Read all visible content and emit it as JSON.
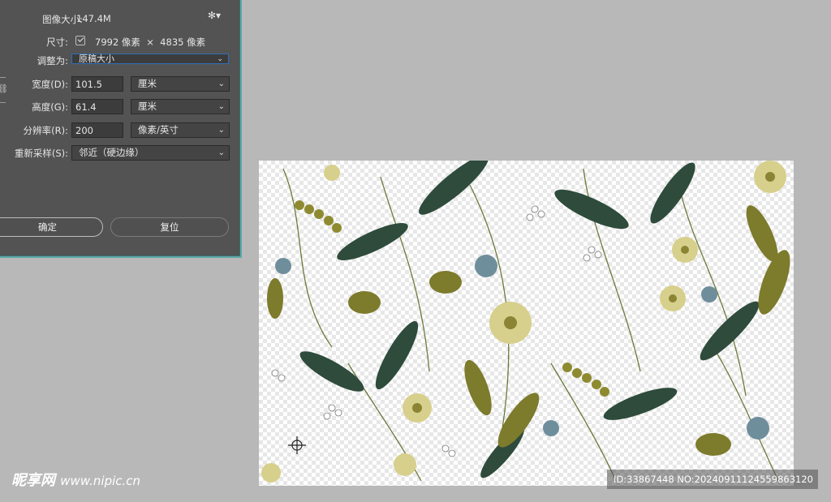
{
  "dialog": {
    "image_size_label": "图像大小:",
    "image_size_value": "147.4M",
    "dimensions_label": "尺寸:",
    "dimensions_value": "7992 像素  ×  4835 像素",
    "fit_to_label": "调整为:",
    "fit_to_value": "原稿大小",
    "width_label": "宽度(D):",
    "width_value": "101.5",
    "width_unit": "厘米",
    "height_label": "高度(G):",
    "height_value": "61.4",
    "height_unit": "厘米",
    "resolution_label": "分辨率(R):",
    "resolution_value": "200",
    "resolution_unit": "像素/英寸",
    "resample_label": "重新采样(S):",
    "resample_value": "邻近（硬边缘）",
    "ok_label": "确定",
    "reset_label": "复位",
    "gear_icon": "gear-icon"
  },
  "watermark": {
    "brand": "昵享网",
    "url": "www.nipic.cn",
    "id_text": "ID:33867448 NO:20240911124559863120"
  },
  "colors": {
    "workspace": "#b8b8b8",
    "dialog_bg": "#535353",
    "dialog_border": "#5fa7a7",
    "leaf_dark": "#2f4a3a",
    "leaf_olive": "#7a7a2a",
    "flower_cream": "#d8d29a",
    "flower_blue": "#6e8ea0"
  }
}
